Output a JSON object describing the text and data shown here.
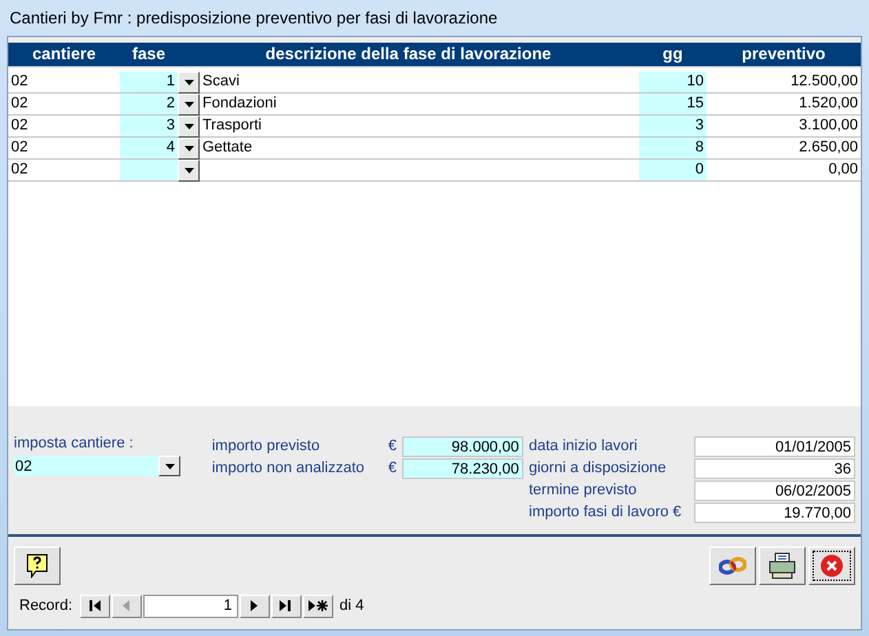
{
  "window": {
    "title": "Cantieri by Fmr : predisposizione preventivo per fasi di lavorazione"
  },
  "table": {
    "columns": [
      "cantiere",
      "fase",
      "descrizione della fase di lavorazione",
      "gg",
      "preventivo"
    ],
    "rows": [
      {
        "cantiere": "02",
        "fase": "1",
        "descrizione": "Scavi",
        "gg": "10",
        "preventivo": "12.500,00"
      },
      {
        "cantiere": "02",
        "fase": "2",
        "descrizione": "Fondazioni",
        "gg": "15",
        "preventivo": "1.520,00"
      },
      {
        "cantiere": "02",
        "fase": "3",
        "descrizione": "Trasporti",
        "gg": "3",
        "preventivo": "3.100,00"
      },
      {
        "cantiere": "02",
        "fase": "4",
        "descrizione": "Gettate",
        "gg": "8",
        "preventivo": "2.650,00"
      },
      {
        "cantiere": "02",
        "descrizione": "",
        "gg": "0",
        "preventivo": "0,00"
      }
    ]
  },
  "imposta_cantiere": {
    "label": "imposta cantiere :",
    "value": "02"
  },
  "importi": [
    {
      "label": "importo previsto",
      "currency": "€",
      "value": "98.000,00"
    },
    {
      "label": "importo non analizzato",
      "currency": "€",
      "value": "78.230,00"
    }
  ],
  "riepilogo": [
    {
      "label": "data inizio lavori",
      "value": "01/01/2005"
    },
    {
      "label": "giorni a disposizione",
      "value": "36"
    },
    {
      "label": "termine previsto",
      "value": "06/02/2005"
    },
    {
      "label": "importo fasi di lavoro  €",
      "value": "19.770,00"
    }
  ],
  "record_nav": {
    "label": "Record:",
    "current": "1",
    "total": "di 4",
    "buttons": [
      {
        "kind": "first",
        "disabled": false
      },
      {
        "kind": "prev",
        "disabled": true
      },
      {
        "kind": "next",
        "disabled": false
      },
      {
        "kind": "last",
        "disabled": false
      },
      {
        "kind": "new",
        "disabled": false
      }
    ]
  }
}
